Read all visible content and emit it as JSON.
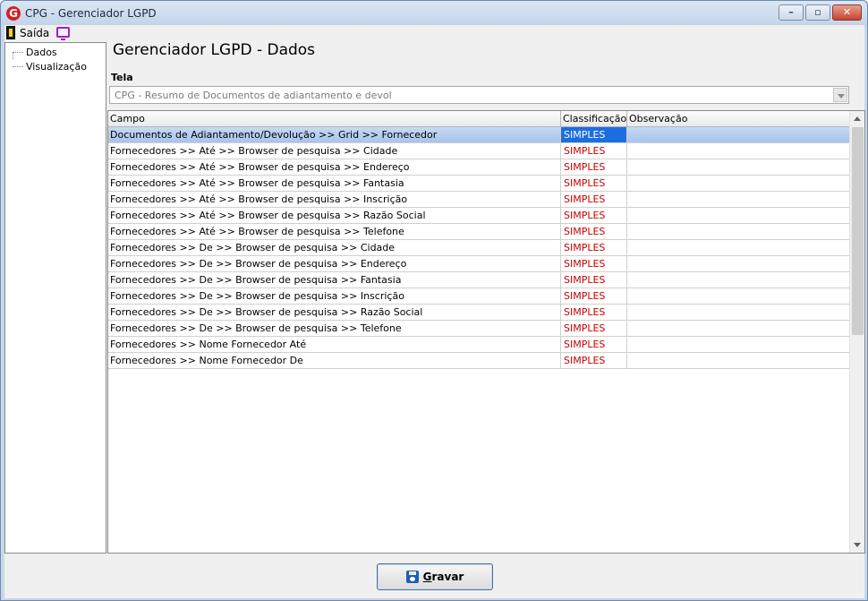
{
  "window": {
    "title": "CPG - Gerenciador LGPD"
  },
  "menu": {
    "exit_label": "Saída"
  },
  "tree": {
    "items": [
      "Dados",
      "Visualização"
    ]
  },
  "main": {
    "title": "Gerenciador LGPD - Dados",
    "tela_label": "Tela",
    "tela_value": "CPG - Resumo de Documentos de adiantamento e devol"
  },
  "grid": {
    "columns": [
      "Campo",
      "Classificação",
      "Observação"
    ],
    "rows": [
      {
        "campo": "Documentos de Adiantamento/Devolução >> Grid >> Fornecedor",
        "classificacao": "SIMPLES",
        "observacao": ""
      },
      {
        "campo": "Fornecedores >> Até >> Browser de pesquisa >> Cidade",
        "classificacao": "SIMPLES",
        "observacao": ""
      },
      {
        "campo": "Fornecedores >> Até >> Browser de pesquisa >> Endereço",
        "classificacao": "SIMPLES",
        "observacao": ""
      },
      {
        "campo": "Fornecedores >> Até >> Browser de pesquisa >> Fantasia",
        "classificacao": "SIMPLES",
        "observacao": ""
      },
      {
        "campo": "Fornecedores >> Até >> Browser de pesquisa >> Inscrição",
        "classificacao": "SIMPLES",
        "observacao": ""
      },
      {
        "campo": "Fornecedores >> Até >> Browser de pesquisa >> Razão Social",
        "classificacao": "SIMPLES",
        "observacao": ""
      },
      {
        "campo": "Fornecedores >> Até >> Browser de pesquisa >> Telefone",
        "classificacao": "SIMPLES",
        "observacao": ""
      },
      {
        "campo": "Fornecedores >> De >> Browser de pesquisa >> Cidade",
        "classificacao": "SIMPLES",
        "observacao": ""
      },
      {
        "campo": "Fornecedores >> De >> Browser de pesquisa >> Endereço",
        "classificacao": "SIMPLES",
        "observacao": ""
      },
      {
        "campo": "Fornecedores >> De >> Browser de pesquisa >> Fantasia",
        "classificacao": "SIMPLES",
        "observacao": ""
      },
      {
        "campo": "Fornecedores >> De >> Browser de pesquisa >> Inscrição",
        "classificacao": "SIMPLES",
        "observacao": ""
      },
      {
        "campo": "Fornecedores >> De >> Browser de pesquisa >> Razão Social",
        "classificacao": "SIMPLES",
        "observacao": ""
      },
      {
        "campo": "Fornecedores >> De >> Browser de pesquisa >> Telefone",
        "classificacao": "SIMPLES",
        "observacao": ""
      },
      {
        "campo": "Fornecedores >> Nome Fornecedor Até",
        "classificacao": "SIMPLES",
        "observacao": ""
      },
      {
        "campo": "Fornecedores >> Nome Fornecedor De",
        "classificacao": "SIMPLES",
        "observacao": ""
      }
    ]
  },
  "footer": {
    "save_first": "G",
    "save_rest": "ravar"
  },
  "colors": {
    "classification": "#cc0000",
    "selection": "#1c6ee0"
  },
  "icons": [
    "app-logo-icon",
    "minimize-icon",
    "maximize-icon",
    "close-icon",
    "exit-door-icon",
    "monitor-icon",
    "chevron-down-icon",
    "scroll-up-icon",
    "scroll-down-icon",
    "save-disk-icon"
  ]
}
